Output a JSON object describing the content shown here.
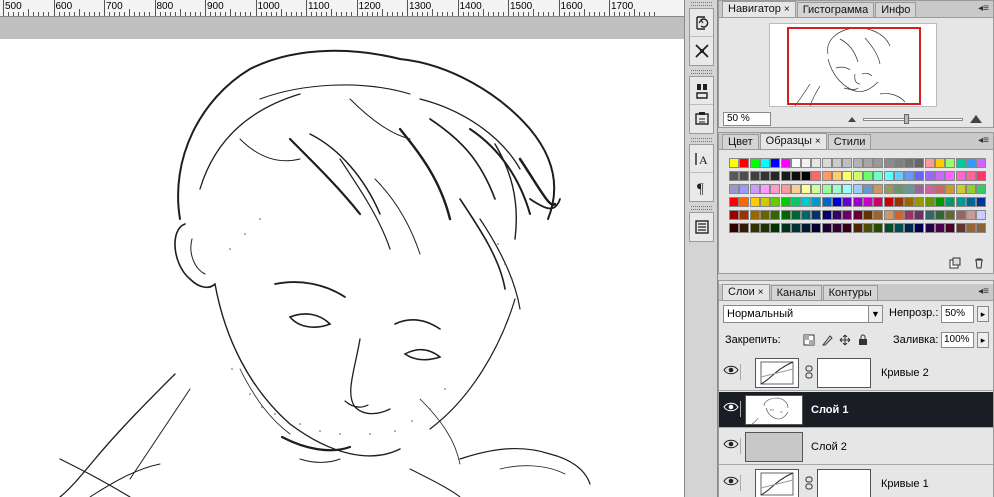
{
  "ruler": {
    "labels": [
      "500",
      "600",
      "700",
      "800",
      "900",
      "1000",
      "1100",
      "1200",
      "1300",
      "1400",
      "1500",
      "1600",
      "1700"
    ]
  },
  "tools": {
    "group1": [
      "history-brush-icon",
      "tool-presets-icon"
    ],
    "group2": [
      "brushes-icon",
      "clone-source-icon"
    ],
    "group3": [
      "character-icon",
      "paragraph-icon"
    ],
    "group4": [
      "notes-icon"
    ]
  },
  "navigator": {
    "tabs": [
      "Навигатор",
      "Гистограмма",
      "Инфо"
    ],
    "zoom_value": "50 %"
  },
  "swatches": {
    "tabs": [
      "Цвет",
      "Образцы",
      "Стили"
    ],
    "rows": [
      [
        "#ffff00",
        "#ff0000",
        "#00ff00",
        "#00ffff",
        "#0000ff",
        "#ff00ff",
        "#ffffff",
        "#f2f2f2",
        "#e6e6e6",
        "#d9d9d9",
        "#cccccc",
        "#bfbfbf",
        "#b3b3b3",
        "#a6a6a6",
        "#999999",
        "#8c8c8c",
        "#808080",
        "#737373",
        "#666666",
        "#ff9999",
        "#ffcc00",
        "#99ff66",
        "#00cc99",
        "#3399ff",
        "#cc66ff"
      ],
      [
        "#595959",
        "#4d4d4d",
        "#404040",
        "#333333",
        "#262626",
        "#1a1a1a",
        "#0d0d0d",
        "#000000",
        "#ff6666",
        "#ff9966",
        "#ffcc66",
        "#ffff66",
        "#ccff66",
        "#66ff66",
        "#66ffcc",
        "#66ffff",
        "#66ccff",
        "#6699ff",
        "#6666ff",
        "#9966ff",
        "#cc66ff",
        "#ff66ff",
        "#ff66cc",
        "#ff6699",
        "#ff3366"
      ],
      [
        "#9999cc",
        "#9999ff",
        "#cc99ff",
        "#ff99ff",
        "#ff99cc",
        "#ff9999",
        "#ffcc99",
        "#ffff99",
        "#ccff99",
        "#99ff99",
        "#99ffcc",
        "#99ffff",
        "#99ccff",
        "#6699cc",
        "#cc9966",
        "#999966",
        "#669966",
        "#669999",
        "#996699",
        "#cc6699",
        "#cc6666",
        "#cc9933",
        "#cccc33",
        "#99cc33",
        "#33cc66"
      ],
      [
        "#ff0000",
        "#ff6600",
        "#ffcc00",
        "#cccc00",
        "#66cc00",
        "#00cc00",
        "#00cc66",
        "#00cccc",
        "#0099cc",
        "#0066cc",
        "#0000cc",
        "#6600cc",
        "#9900cc",
        "#cc00cc",
        "#cc0066",
        "#cc0000",
        "#993300",
        "#996600",
        "#999900",
        "#669900",
        "#009900",
        "#009966",
        "#009999",
        "#006699",
        "#003399"
      ],
      [
        "#990000",
        "#993300",
        "#996600",
        "#666600",
        "#336600",
        "#006600",
        "#006633",
        "#006666",
        "#003366",
        "#000066",
        "#330066",
        "#660066",
        "#660033",
        "#663300",
        "#996633",
        "#cc9966",
        "#cc6633",
        "#993366",
        "#663366",
        "#336666",
        "#336633",
        "#666633",
        "#996666",
        "#cc9999",
        "#ccccff"
      ],
      [
        "#330000",
        "#331a00",
        "#333300",
        "#1a3300",
        "#003300",
        "#00331a",
        "#003333",
        "#001a33",
        "#000033",
        "#1a0033",
        "#330033",
        "#33001a",
        "#4d2600",
        "#4d4d00",
        "#264d00",
        "#004d26",
        "#004d4d",
        "#00264d",
        "#00004d",
        "#26004d",
        "#4d004d",
        "#4d0026",
        "#663333",
        "#996633",
        "#8c6239"
      ]
    ]
  },
  "layers": {
    "tabs": [
      "Слои",
      "Каналы",
      "Контуры"
    ],
    "blend_mode": "Нормальный",
    "opacity_label": "Непрозр.:",
    "opacity_value": "50%",
    "lock_label": "Закрепить:",
    "fill_label": "Заливка:",
    "fill_value": "100%",
    "items": [
      {
        "name": "Кривые 2",
        "kind": "adjustment",
        "selected": false
      },
      {
        "name": "Слой 1",
        "kind": "pixel-sketch",
        "selected": true
      },
      {
        "name": "Слой 2",
        "kind": "pixel-grey",
        "selected": false
      },
      {
        "name": "Кривые 1",
        "kind": "adjustment",
        "selected": false
      }
    ]
  },
  "colors": {
    "nav_view_box": "#d12020",
    "selected_layer": "#1a1d24",
    "panel_bg": "#e6e6e6"
  }
}
